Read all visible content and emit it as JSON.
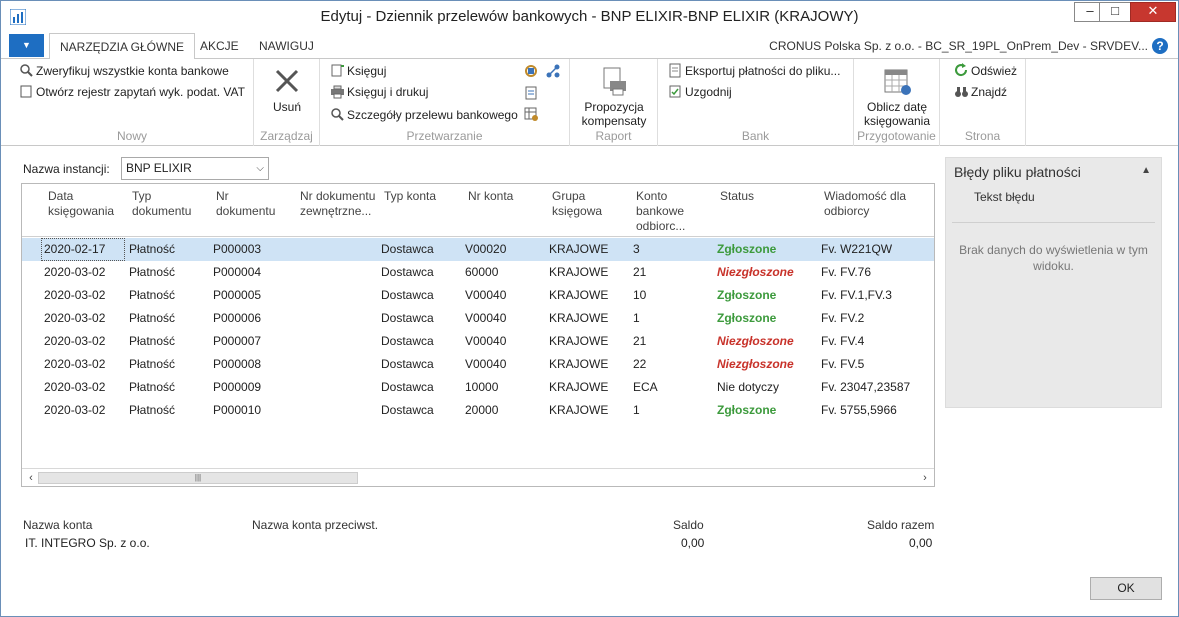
{
  "window": {
    "title": "Edytuj - Dziennik przelewów bankowych - BNP ELIXIR-BNP ELIXIR (KRAJOWY)",
    "minimize": "–",
    "maximize": "□",
    "close": "✕"
  },
  "tabs": {
    "home": "NARZĘDZIA GŁÓWNE",
    "actions": "AKCJE",
    "navigate": "NAWIGUJ",
    "company": "CRONUS Polska Sp. z o.o. - BC_SR_19PL_OnPrem_Dev - SRVDEV...",
    "help": "?"
  },
  "ribbon": {
    "nowy": {
      "label": "Nowy",
      "verify": "Zweryfikuj wszystkie konta bankowe",
      "open_registry": "Otwórz rejestr zapytań wyk. podat. VAT"
    },
    "zarzadzaj": {
      "label": "Zarządzaj",
      "delete": "Usuń"
    },
    "przetwarzanie": {
      "label": "Przetwarzanie",
      "post": "Księguj",
      "post_print": "Księguj i drukuj",
      "details": "Szczegóły przelewu bankowego"
    },
    "raport": {
      "label": "Raport",
      "proposal": "Propozycja kompensaty"
    },
    "bank": {
      "label": "Bank",
      "export": "Eksportuj płatności do pliku...",
      "reconcile": "Uzgodnij"
    },
    "przygotowanie": {
      "label": "Przygotowanie",
      "calc_date": "Oblicz datę księgowania"
    },
    "strona": {
      "label": "Strona",
      "refresh": "Odśwież",
      "find": "Znajdź"
    }
  },
  "instance": {
    "label": "Nazwa instancji:",
    "value": "BNP ELIXIR"
  },
  "table": {
    "headers": {
      "date": "Data księgowania",
      "doctype": "Typ dokumentu",
      "docno": "Nr dokumentu",
      "extdoc": "Nr dokumentu zewnętrzne...",
      "accttype": "Typ konta",
      "acctno": "Nr konta",
      "group": "Grupa księgowa",
      "recip": "Konto bankowe odbiorc...",
      "status": "Status",
      "msg": "Wiadomość dla odbiorcy"
    },
    "rows": [
      {
        "date": "2020-02-17",
        "doctype": "Płatność",
        "docno": "P000003",
        "extdoc": "",
        "accttype": "Dostawca",
        "acctno": "V00020",
        "group": "KRAJOWE",
        "recip": "3",
        "status": "Zgłoszone",
        "msg": "Fv. W221QW"
      },
      {
        "date": "2020-03-02",
        "doctype": "Płatność",
        "docno": "P000004",
        "extdoc": "",
        "accttype": "Dostawca",
        "acctno": "60000",
        "group": "KRAJOWE",
        "recip": "21",
        "status": "Niezgłoszone",
        "msg": "Fv. FV.76"
      },
      {
        "date": "2020-03-02",
        "doctype": "Płatność",
        "docno": "P000005",
        "extdoc": "",
        "accttype": "Dostawca",
        "acctno": "V00040",
        "group": "KRAJOWE",
        "recip": "10",
        "status": "Zgłoszone",
        "msg": "Fv. FV.1,FV.3"
      },
      {
        "date": "2020-03-02",
        "doctype": "Płatność",
        "docno": "P000006",
        "extdoc": "",
        "accttype": "Dostawca",
        "acctno": "V00040",
        "group": "KRAJOWE",
        "recip": "1",
        "status": "Zgłoszone",
        "msg": "Fv. FV.2"
      },
      {
        "date": "2020-03-02",
        "doctype": "Płatność",
        "docno": "P000007",
        "extdoc": "",
        "accttype": "Dostawca",
        "acctno": "V00040",
        "group": "KRAJOWE",
        "recip": "21",
        "status": "Niezgłoszone",
        "msg": "Fv. FV.4"
      },
      {
        "date": "2020-03-02",
        "doctype": "Płatność",
        "docno": "P000008",
        "extdoc": "",
        "accttype": "Dostawca",
        "acctno": "V00040",
        "group": "KRAJOWE",
        "recip": "22",
        "status": "Niezgłoszone",
        "msg": "Fv. FV.5"
      },
      {
        "date": "2020-03-02",
        "doctype": "Płatność",
        "docno": "P000009",
        "extdoc": "",
        "accttype": "Dostawca",
        "acctno": "10000",
        "group": "KRAJOWE",
        "recip": "ECA",
        "status": "Nie dotyczy",
        "msg": "Fv. 23047,23587"
      },
      {
        "date": "2020-03-02",
        "doctype": "Płatność",
        "docno": "P000010",
        "extdoc": "",
        "accttype": "Dostawca",
        "acctno": "20000",
        "group": "KRAJOWE",
        "recip": "1",
        "status": "Zgłoszone",
        "msg": "Fv. 5755,5966"
      }
    ]
  },
  "side_panel": {
    "title": "Błędy pliku płatności",
    "column": "Tekst błędu",
    "empty": "Brak danych do wyświetlenia w tym widoku."
  },
  "footer": {
    "account_name_label": "Nazwa konta",
    "account_name": "IT. INTEGRO Sp. z o.o.",
    "counter_label": "Nazwa konta przeciwst.",
    "balance_label": "Saldo",
    "balance": "0,00",
    "total_label": "Saldo razem",
    "total": "0,00"
  },
  "ok_button": "OK",
  "colors": {
    "accent": "#1e6ec2",
    "selected_row": "#cfe3f5",
    "status_ok": "#3c9a3c",
    "status_no": "#c8322a"
  }
}
